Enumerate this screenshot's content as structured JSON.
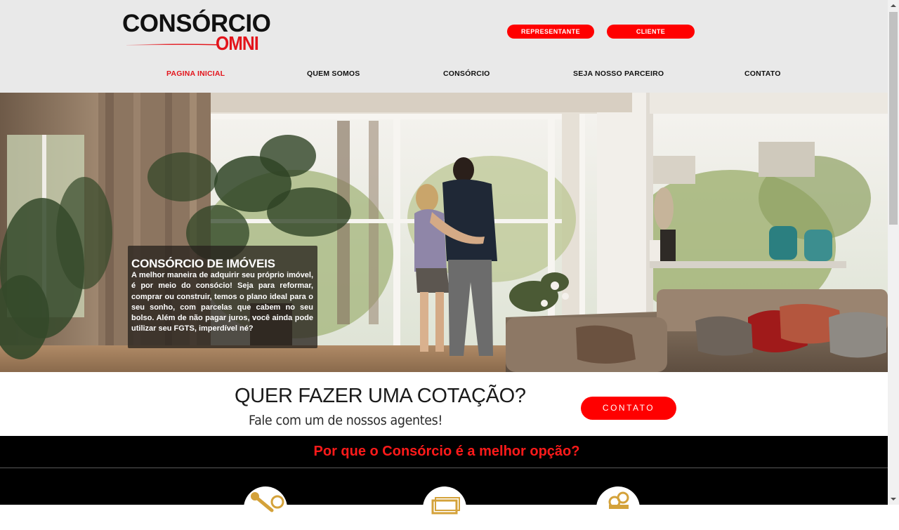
{
  "brand": {
    "logo_top": "CONSÓRCIO",
    "logo_bottom": "OMNI",
    "primary_color": "#ff0000",
    "logo_red": "#e3141b"
  },
  "header": {
    "buttons": {
      "representante": "REPRESENTANTE",
      "cliente": "CLIENTE"
    },
    "nav": [
      {
        "label": "PAGINA INICIAL",
        "active": true
      },
      {
        "label": "QUEM SOMOS",
        "active": false
      },
      {
        "label": "CONSÓRCIO",
        "active": false
      },
      {
        "label": "SEJA NOSSO PARCEIRO",
        "active": false
      },
      {
        "label": "CONTATO",
        "active": false
      }
    ]
  },
  "hero": {
    "title": "CONSÓRCIO DE IMÓVEIS",
    "text": "A melhor maneira de adquirir seu próprio imóvel, é por meio do consócio! Seja para reformar, comprar ou construir, temos o plano ideal para o seu sonho, com parcelas que cabem no seu bolso. Além de não pagar juros, você ainda pode utilizar seu FGTS, imperdível né?"
  },
  "quote": {
    "title": "QUER FAZER UMA COTAÇÃO?",
    "subtitle": "Fale com um de nossos agentes!",
    "button": "CONTATO"
  },
  "why": {
    "title": "Por que o Consórcio é a melhor opção?",
    "icons": [
      "keys-icon",
      "money-bill-icon",
      "coins-icon"
    ]
  }
}
